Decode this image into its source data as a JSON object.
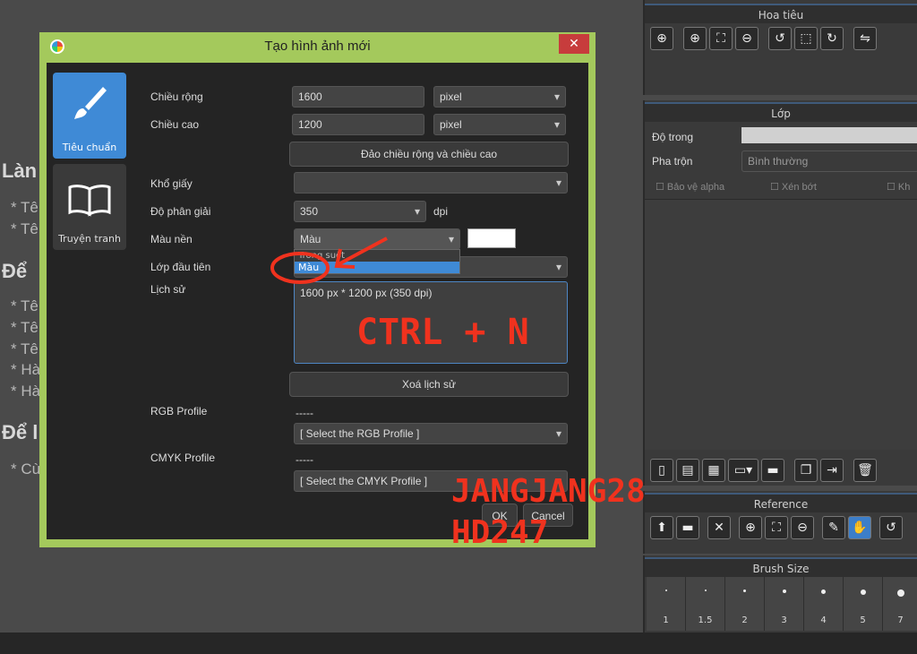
{
  "background_doc": {
    "headings": [
      "Làn",
      "Để",
      "Để l"
    ],
    "bullets": [
      "* Tê",
      "* Tê",
      "* Tê",
      "* Tê",
      "* Tê",
      "* Hà",
      "* Hà",
      "* Cù"
    ]
  },
  "navigator": {
    "title": "Hoa tiêu",
    "tools": [
      "zoom-fit-icon",
      "zoom-in-icon",
      "fit-icon",
      "zoom-out-icon",
      "rotate-left-icon",
      "fullscreen-icon",
      "rotate-right-icon",
      "flip-icon"
    ]
  },
  "layer_panel": {
    "title": "Lớp",
    "opacity_label": "Độ trong",
    "blend_label": "Pha trộn",
    "blend_value": "Bình thường",
    "checks": [
      "Bảo vệ alpha",
      "Xén bớt",
      "Kh"
    ]
  },
  "reference_panel": {
    "title": "Reference"
  },
  "brush_size": {
    "title": "Brush Size",
    "sizes": [
      "1",
      "1.5",
      "2",
      "3",
      "4",
      "5",
      "7"
    ]
  },
  "dialog": {
    "title": "Tạo hình ảnh mới",
    "close": "✕",
    "modes": [
      "Tiêu chuẩn",
      "Truyện tranh"
    ],
    "width_label": "Chiều rộng",
    "width_value": "1600",
    "width_unit": "pixel",
    "height_label": "Chiều cao",
    "height_value": "1200",
    "height_unit": "pixel",
    "swap_button": "Đảo chiều rộng và chiều cao",
    "paper_label": "Khổ giấy",
    "paper_value": "",
    "resolution_label": "Độ phân giải",
    "resolution_value": "350",
    "resolution_unit": "dpi",
    "bgcolor_label": "Màu nền",
    "bgcolor_value": "Màu",
    "bgcolor_options": [
      "Trong suốt",
      "Màu"
    ],
    "first_layer_label": "Lớp đầu tiên",
    "history_label": "Lịch sử",
    "history_items": [
      "1600 px * 1200 px (350 dpi)"
    ],
    "clear_history": "Xoá lịch sử",
    "rgb_label": "RGB Profile",
    "rgb_dash": "-----",
    "rgb_select": "[ Select the RGB Profile ]",
    "cmyk_label": "CMYK Profile",
    "cmyk_dash": "-----",
    "cmyk_select": "[ Select the CMYK Profile ]",
    "ok": "OK",
    "cancel": "Cancel"
  },
  "annotations": {
    "shortcut": "CTRL + N",
    "watermark_1": "JANGJANG28",
    "watermark_2": "HD247"
  },
  "colors": {
    "accent": "#3f8ad6",
    "dialog_frame": "#a4c95c",
    "annotation": "#f0321e"
  }
}
